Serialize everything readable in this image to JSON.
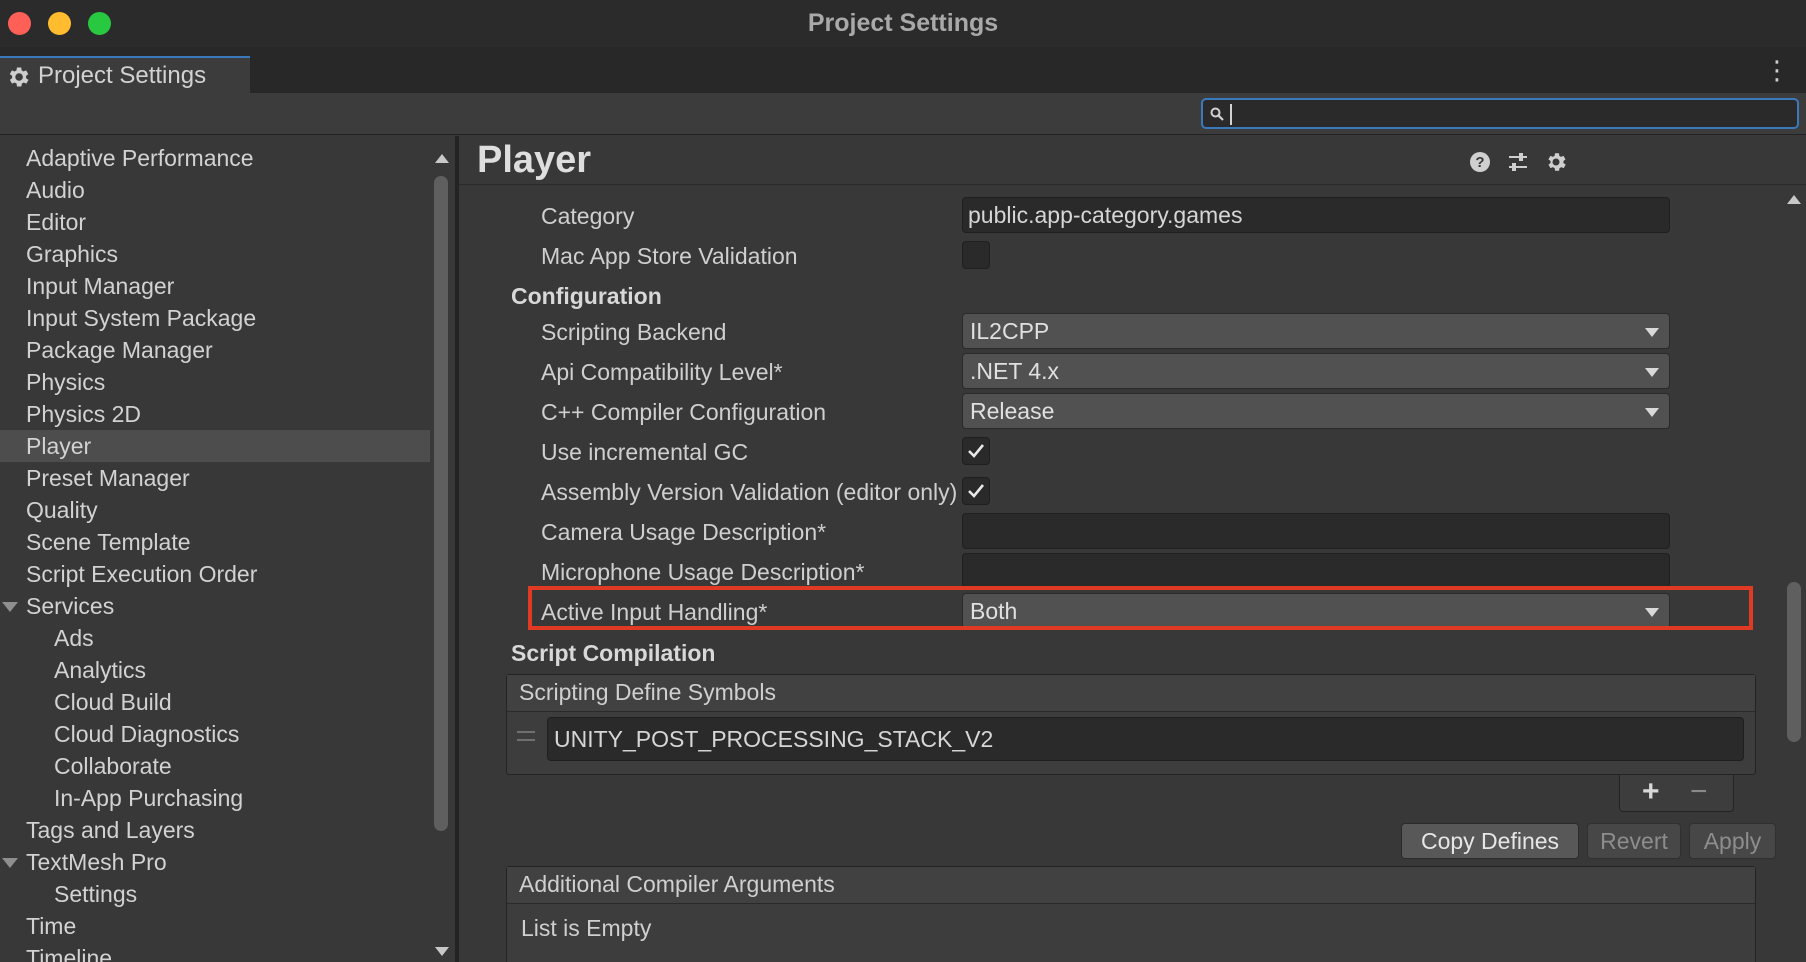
{
  "window": {
    "title": "Project Settings"
  },
  "tab": {
    "label": "Project Settings",
    "icon": "gear-icon"
  },
  "search": {
    "value": "",
    "placeholder": ""
  },
  "sidebar": {
    "items": [
      {
        "label": "Adaptive Performance"
      },
      {
        "label": "Audio"
      },
      {
        "label": "Editor"
      },
      {
        "label": "Graphics"
      },
      {
        "label": "Input Manager"
      },
      {
        "label": "Input System Package"
      },
      {
        "label": "Package Manager"
      },
      {
        "label": "Physics"
      },
      {
        "label": "Physics 2D"
      },
      {
        "label": "Player",
        "selected": true
      },
      {
        "label": "Preset Manager"
      },
      {
        "label": "Quality"
      },
      {
        "label": "Scene Template"
      },
      {
        "label": "Script Execution Order"
      },
      {
        "label": "Services",
        "expanded": true
      },
      {
        "label": "Ads",
        "child": true
      },
      {
        "label": "Analytics",
        "child": true
      },
      {
        "label": "Cloud Build",
        "child": true
      },
      {
        "label": "Cloud Diagnostics",
        "child": true
      },
      {
        "label": "Collaborate",
        "child": true
      },
      {
        "label": "In-App Purchasing",
        "child": true
      },
      {
        "label": "Tags and Layers"
      },
      {
        "label": "TextMesh Pro",
        "expanded": true
      },
      {
        "label": "Settings",
        "child": true
      },
      {
        "label": "Time"
      },
      {
        "label": "Timeline"
      }
    ]
  },
  "main": {
    "title": "Player",
    "category": {
      "label": "Category",
      "value": "public.app-category.games"
    },
    "mac_app_store_validation": {
      "label": "Mac App Store Validation",
      "checked": false
    },
    "configuration": {
      "heading": "Configuration",
      "scripting_backend": {
        "label": "Scripting Backend",
        "value": "IL2CPP"
      },
      "api_compat": {
        "label": "Api Compatibility Level*",
        "value": ".NET 4.x"
      },
      "cpp_compiler": {
        "label": "C++ Compiler Configuration",
        "value": "Release"
      },
      "incremental_gc": {
        "label": "Use incremental GC",
        "checked": true
      },
      "assembly_validation": {
        "label": "Assembly Version Validation (editor only)",
        "checked": true
      },
      "camera_usage": {
        "label": "Camera Usage Description*",
        "value": ""
      },
      "microphone_usage": {
        "label": "Microphone Usage Description*",
        "value": ""
      },
      "active_input": {
        "label": "Active Input Handling*",
        "value": "Both"
      }
    },
    "script_compilation": {
      "heading": "Script Compilation",
      "defines_header": "Scripting Define Symbols",
      "defines": [
        "UNITY_POST_PROCESSING_STACK_V2"
      ],
      "plus_label": "+",
      "minus_label": "−",
      "copy_defines_label": "Copy Defines",
      "revert_label": "Revert",
      "apply_label": "Apply",
      "compiler_args_header": "Additional Compiler Arguments",
      "compiler_args_empty": "List is Empty"
    }
  },
  "colors": {
    "accent": "#3a79bb",
    "highlight": "#e03b22",
    "background": "#383838"
  }
}
